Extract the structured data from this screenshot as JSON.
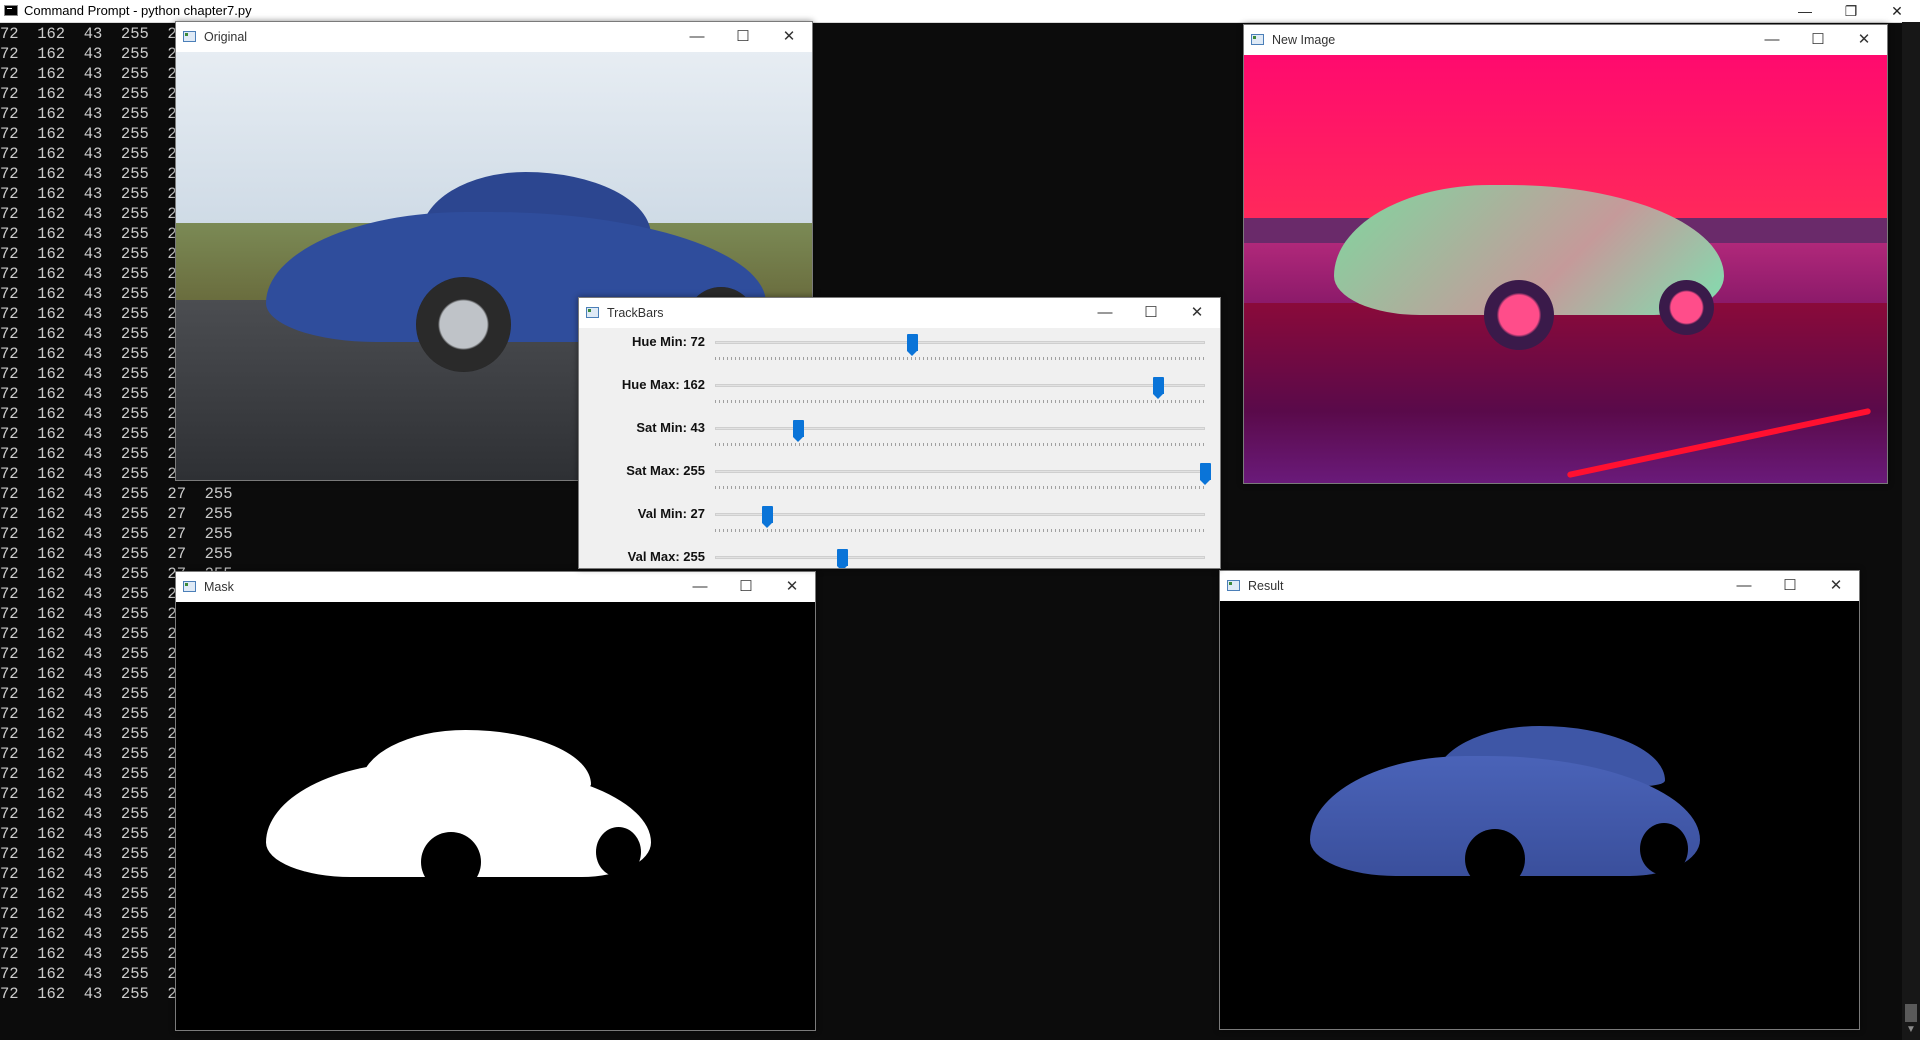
{
  "console": {
    "title": "Command Prompt - python  chapter7.py",
    "line": "72  162  43  255  27  255",
    "line_count": 49
  },
  "window_controls": {
    "minimize": "—",
    "maximize": "☐",
    "close": "✕",
    "restore": "❐"
  },
  "windows": {
    "original": {
      "title": "Original"
    },
    "new_image": {
      "title": "New Image"
    },
    "trackbars": {
      "title": "TrackBars"
    },
    "mask": {
      "title": "Mask"
    },
    "result": {
      "title": "Result"
    }
  },
  "trackbars": [
    {
      "label": "Hue Min:",
      "value": 72,
      "max": 179
    },
    {
      "label": "Hue Max:",
      "value": 162,
      "max": 179
    },
    {
      "label": "Sat Min:",
      "value": 43,
      "max": 255
    },
    {
      "label": "Sat Max:",
      "value": 255,
      "max": 255
    },
    {
      "label": "Val Min:",
      "value": 27,
      "max": 255
    },
    {
      "label": "Val Max:",
      "value": 255,
      "max": 255
    }
  ],
  "colors": {
    "console_bg": "#0c0c0c",
    "console_text": "#cccccc",
    "slider_thumb": "#0a74d8"
  }
}
